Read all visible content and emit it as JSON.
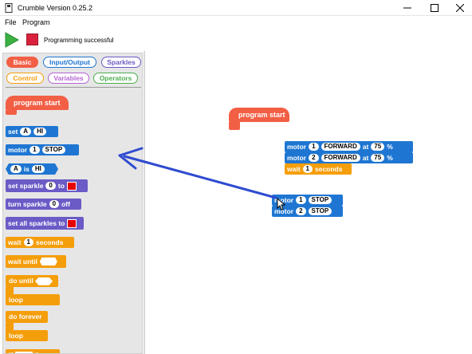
{
  "window": {
    "title": "Crumble Version 0.25.2",
    "minimize_icon": "minimize-icon",
    "maximize_icon": "maximize-icon",
    "close_icon": "close-icon"
  },
  "menubar": {
    "file": "File",
    "program": "Program"
  },
  "toolbar": {
    "status": "Programming successful"
  },
  "categories": [
    {
      "label": "Basic",
      "color": "#f25f45",
      "active": true
    },
    {
      "label": "Input/Output",
      "color": "#1f76d2"
    },
    {
      "label": "Sparkles",
      "color": "#6a5bc6"
    },
    {
      "label": "Control",
      "color": "#f59e0b"
    },
    {
      "label": "Variables",
      "color": "#b566d6"
    },
    {
      "label": "Operators",
      "color": "#4caf50"
    }
  ],
  "palette": {
    "program_start": "program start",
    "set": {
      "label": "set",
      "var": "A",
      "value": "HI"
    },
    "motor": {
      "label": "motor",
      "num": "1",
      "value": "STOP"
    },
    "compare": {
      "var": "A",
      "is": "is",
      "value": "HI"
    },
    "set_sparkle": {
      "label": "set sparkle",
      "num": "0",
      "to": "to"
    },
    "turn_sparkle": {
      "label": "turn sparkle",
      "num": "0",
      "off": "off"
    },
    "set_all_sparkles": {
      "label": "set all sparkles to"
    },
    "wait": {
      "label": "wait",
      "num": "1",
      "unit": "seconds"
    },
    "wait_until": {
      "label": "wait until"
    },
    "do_until": {
      "label": "do until",
      "loop": "loop"
    },
    "do_forever": {
      "label": "do forever",
      "loop": "loop"
    },
    "if_then": {
      "label": "if",
      "then": "then"
    }
  },
  "workspace": {
    "program_start": "program start",
    "motor_forward_1": {
      "label": "motor",
      "num": "1",
      "dir": "FORWARD",
      "at": "at",
      "speed": "75",
      "pct": "%"
    },
    "motor_forward_2": {
      "label": "motor",
      "num": "2",
      "dir": "FORWARD",
      "at": "at",
      "speed": "75",
      "pct": "%"
    },
    "wait": {
      "label": "wait",
      "num": "1",
      "unit": "seconds"
    },
    "motor_stop_1": {
      "label": "motor",
      "num": "1",
      "value": "STOP"
    },
    "motor_stop_2": {
      "label": "motor",
      "num": "2",
      "value": "STOP"
    }
  },
  "annotation": {
    "arrow_color": "#2f4bd0"
  }
}
